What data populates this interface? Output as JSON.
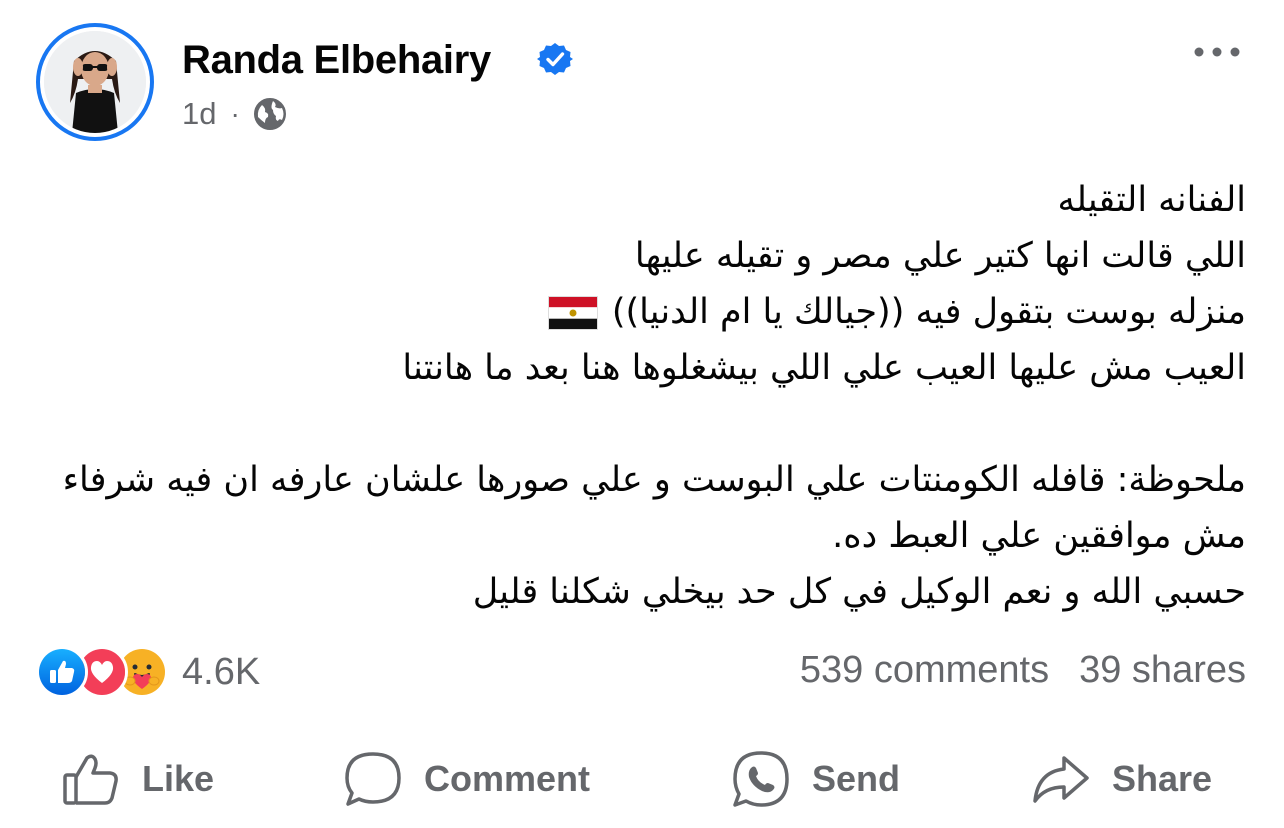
{
  "post": {
    "author": "Randa Elbehairy",
    "time": "1d",
    "separator": "·",
    "audience_icon": "globe-icon",
    "verified_icon": "verified-badge-icon",
    "more_icon": "more-options-icon",
    "lines": [
      "الفنانه التقيله",
      "اللي قالت انها كتير علي مصر و تقيله عليها",
      "منزله بوست بتقول فيه ((جيالك يا ام الدنيا))",
      "العيب مش عليها العيب علي اللي بيشغلوها هنا بعد ما هانتنا",
      "ملحوظة: قافله الكومنتات علي البوست و علي صورها علشان عارفه ان فيه شرفاء مش موافقين علي العبط ده.",
      "حسبي الله و نعم الوكيل في كل حد بيخلي شكلنا قليل"
    ],
    "flag": "egypt-flag-emoji"
  },
  "reactions": {
    "icons": [
      "like-reaction-icon",
      "love-reaction-icon",
      "care-reaction-icon"
    ],
    "count": "4.6K"
  },
  "stats": {
    "comments": "539 comments",
    "shares": "39 shares"
  },
  "actions": {
    "like": "Like",
    "comment": "Comment",
    "send": "Send",
    "share": "Share"
  },
  "colors": {
    "accent": "#1877f2",
    "secondary_text": "#65676b",
    "love": "#f33e58",
    "care": "#f7b125"
  }
}
